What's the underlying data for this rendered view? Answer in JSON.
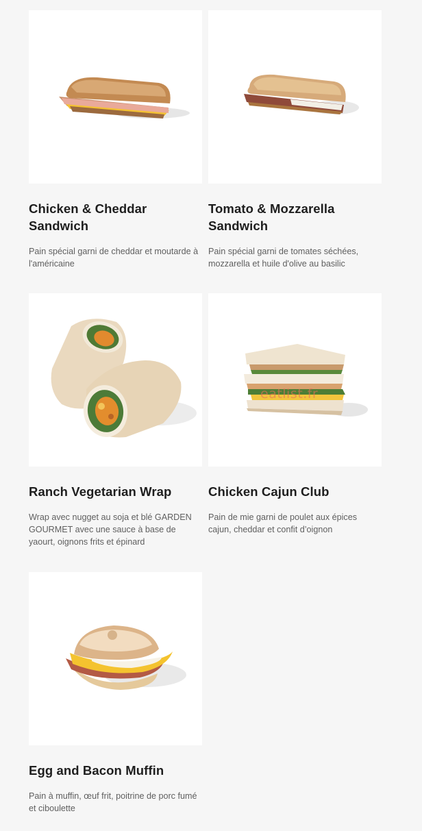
{
  "products": [
    {
      "title": "Chicken & Cheddar Sandwich",
      "description": "Pain spécial garni de cheddar et moutarde à l'américaine",
      "image_icon": "panini-sandwich-icon"
    },
    {
      "title": "Tomato & Mozzarella Sandwich",
      "description": "Pain spécial garni de tomates séchées, mozzarella et huile d'olive au basilic",
      "image_icon": "tomato-mozzarella-sandwich-icon"
    },
    {
      "title": "Ranch Vegetarian Wrap",
      "description": "Wrap avec nugget au soja et blé GARDEN GOURMET avec une sauce à base de yaourt, oignons frits et épinard",
      "image_icon": "wrap-icon"
    },
    {
      "title": "Chicken Cajun Club",
      "description": "Pain de mie garni de poulet aux épices cajun, cheddar et confit d’oignon",
      "image_icon": "club-sandwich-icon",
      "watermark": "eatlist.fr"
    },
    {
      "title": "Egg and Bacon Muffin",
      "description": "Pain à muffin, œuf frit, poitrine de porc fumé et ciboulette",
      "image_icon": "muffin-icon"
    }
  ]
}
